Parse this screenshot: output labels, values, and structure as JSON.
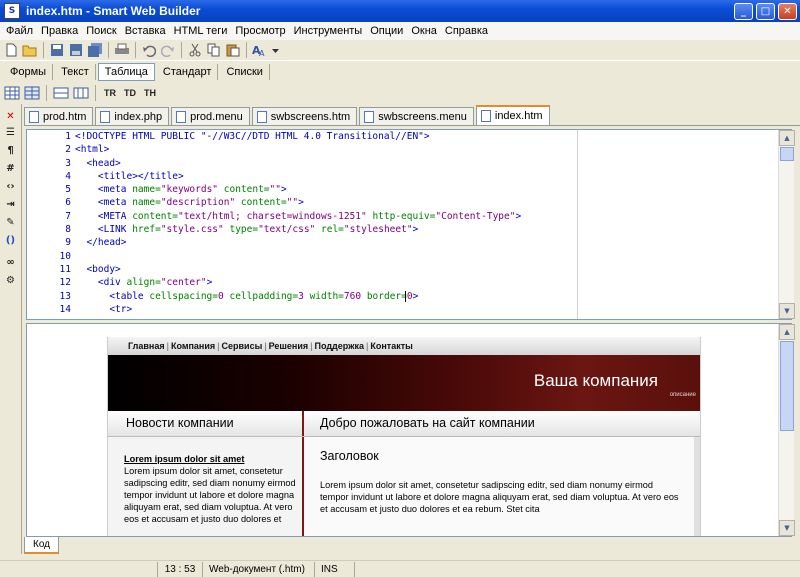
{
  "window": {
    "title": "index.htm - Smart Web Builder",
    "app_icon": "S"
  },
  "menubar": [
    "Файл",
    "Правка",
    "Поиск",
    "Вставка",
    "HTML теги",
    "Просмотр",
    "Инструменты",
    "Опции",
    "Окна",
    "Справка"
  ],
  "toolbar_icons": [
    "new-file-icon",
    "open-folder-icon",
    "save-icon",
    "save-as-icon",
    "save-all-icon",
    "print-icon",
    "undo-icon",
    "redo-icon",
    "cut-icon",
    "copy-icon",
    "paste-icon",
    "find-icon",
    "dropdown-icon"
  ],
  "category_tabs": [
    {
      "label": "Формы",
      "active": false
    },
    {
      "label": "Текст",
      "active": false
    },
    {
      "label": "Таблица",
      "active": true
    },
    {
      "label": "Стандарт",
      "active": false
    },
    {
      "label": "Списки",
      "active": false
    }
  ],
  "tag_buttons": [
    "TR",
    "TD",
    "TH"
  ],
  "file_tabs": [
    {
      "label": "prod.htm",
      "active": false
    },
    {
      "label": "index.php",
      "active": false
    },
    {
      "label": "prod.menu",
      "active": false
    },
    {
      "label": "swbscreens.htm",
      "active": false
    },
    {
      "label": "swbscreens.menu",
      "active": false
    },
    {
      "label": "index.htm",
      "active": true
    }
  ],
  "line_numbers": [
    "1",
    "2",
    "3",
    "4",
    "5",
    "6",
    "7",
    "8",
    "9",
    "10",
    "11",
    "12",
    "13",
    "14"
  ],
  "code_lines": [
    "<!DOCTYPE HTML PUBLIC \"-//W3C//DTD HTML 4.0 Transitional//EN\">",
    "<html>",
    "  <head>",
    "    <title></title>",
    "    <meta name=\"keywords\" content=\"\">",
    "    <meta name=\"description\" content=\"\">",
    "    <META content=\"text/html; charset=windows-1251\" http-equiv=\"Content-Type\">",
    "    <LINK href=\"style.css\" type=\"text/css\" rel=\"stylesheet\">",
    "  </head>",
    "",
    "  <body>",
    "    <div align=\"center\">",
    "      <table cellspacing=0 cellpadding=3 width=760 border=0>",
    "      <tr>"
  ],
  "preview": {
    "nav": [
      "Главная",
      "Компания",
      "Сервисы",
      "Решения",
      "Поддержка",
      "Контакты"
    ],
    "banner_title": "Ваша компания",
    "banner_sub": "описание",
    "left_heading": "Новости компании",
    "right_heading": "Добро пожаловать на сайт компании",
    "news_title": "Lorem ipsum dolor sit amet",
    "news_text": "Lorem ipsum dolor sit amet, consetetur sadipscing editr, sed diam nonumy eirmod tempor invidunt ut labore et dolore magna aliquyam erat, sed diam voluptua. At vero eos et accusam et justo duo dolores et",
    "main_heading": "Заголовок",
    "main_text": "Lorem ipsum dolor sit amet, consetetur sadipscing editr, sed diam nonumy eirmod tempor invidunt ut labore et dolore magna aliquyam erat, sed diam voluptua. At vero eos et accusam et justo duo dolores et ea rebum. Stet cita"
  },
  "bottom_tab": "Код",
  "status": {
    "position": "13 : 53",
    "doctype": "Web-документ (.htm)",
    "mode": "INS"
  },
  "colors": {
    "tag": "#0000c0",
    "attr": "#008000",
    "value": "#800080",
    "active_tab_accent": "#e68b2c"
  }
}
